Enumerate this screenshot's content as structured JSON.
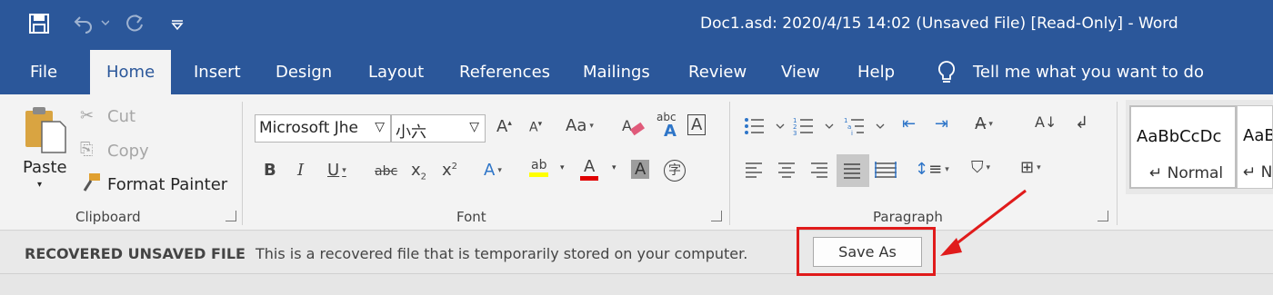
{
  "window": {
    "title": "Doc1.asd: 2020/4/15 14:02 (Unsaved File) [Read-Only]  -  Word"
  },
  "qat": {
    "save_icon": "save-icon",
    "undo_icon": "undo-icon",
    "redo_icon": "redo-icon",
    "customize_icon": "chevron-down-icon"
  },
  "tabs": [
    {
      "label": "File"
    },
    {
      "label": "Home"
    },
    {
      "label": "Insert"
    },
    {
      "label": "Design"
    },
    {
      "label": "Layout"
    },
    {
      "label": "References"
    },
    {
      "label": "Mailings"
    },
    {
      "label": "Review"
    },
    {
      "label": "View"
    },
    {
      "label": "Help"
    }
  ],
  "active_tab": "Home",
  "tell_me": "Tell me what you want to do",
  "clipboard": {
    "paste": "Paste",
    "cut": "Cut",
    "copy": "Copy",
    "format_painter": "Format Painter",
    "label": "Clipboard"
  },
  "font": {
    "name": "Microsoft Jhe",
    "size": "小六",
    "label": "Font",
    "clear_format_glyph": "abc",
    "char_border_glyph": "A",
    "phonetic_glyph": "字"
  },
  "paragraph": {
    "label": "Paragraph"
  },
  "styles": [
    {
      "preview": "AaBbCcDc",
      "name": "↵ Normal"
    },
    {
      "preview": "AaB",
      "name": "↵ No"
    }
  ],
  "notice": {
    "title": "RECOVERED UNSAVED FILE",
    "message": "This is a recovered file that is temporarily stored on your computer.",
    "save_as": "Save As"
  },
  "colors": {
    "brand": "#2b579a",
    "annotation": "#e01b1b",
    "highlight": "#ffff00",
    "font_color": "#e00000"
  }
}
